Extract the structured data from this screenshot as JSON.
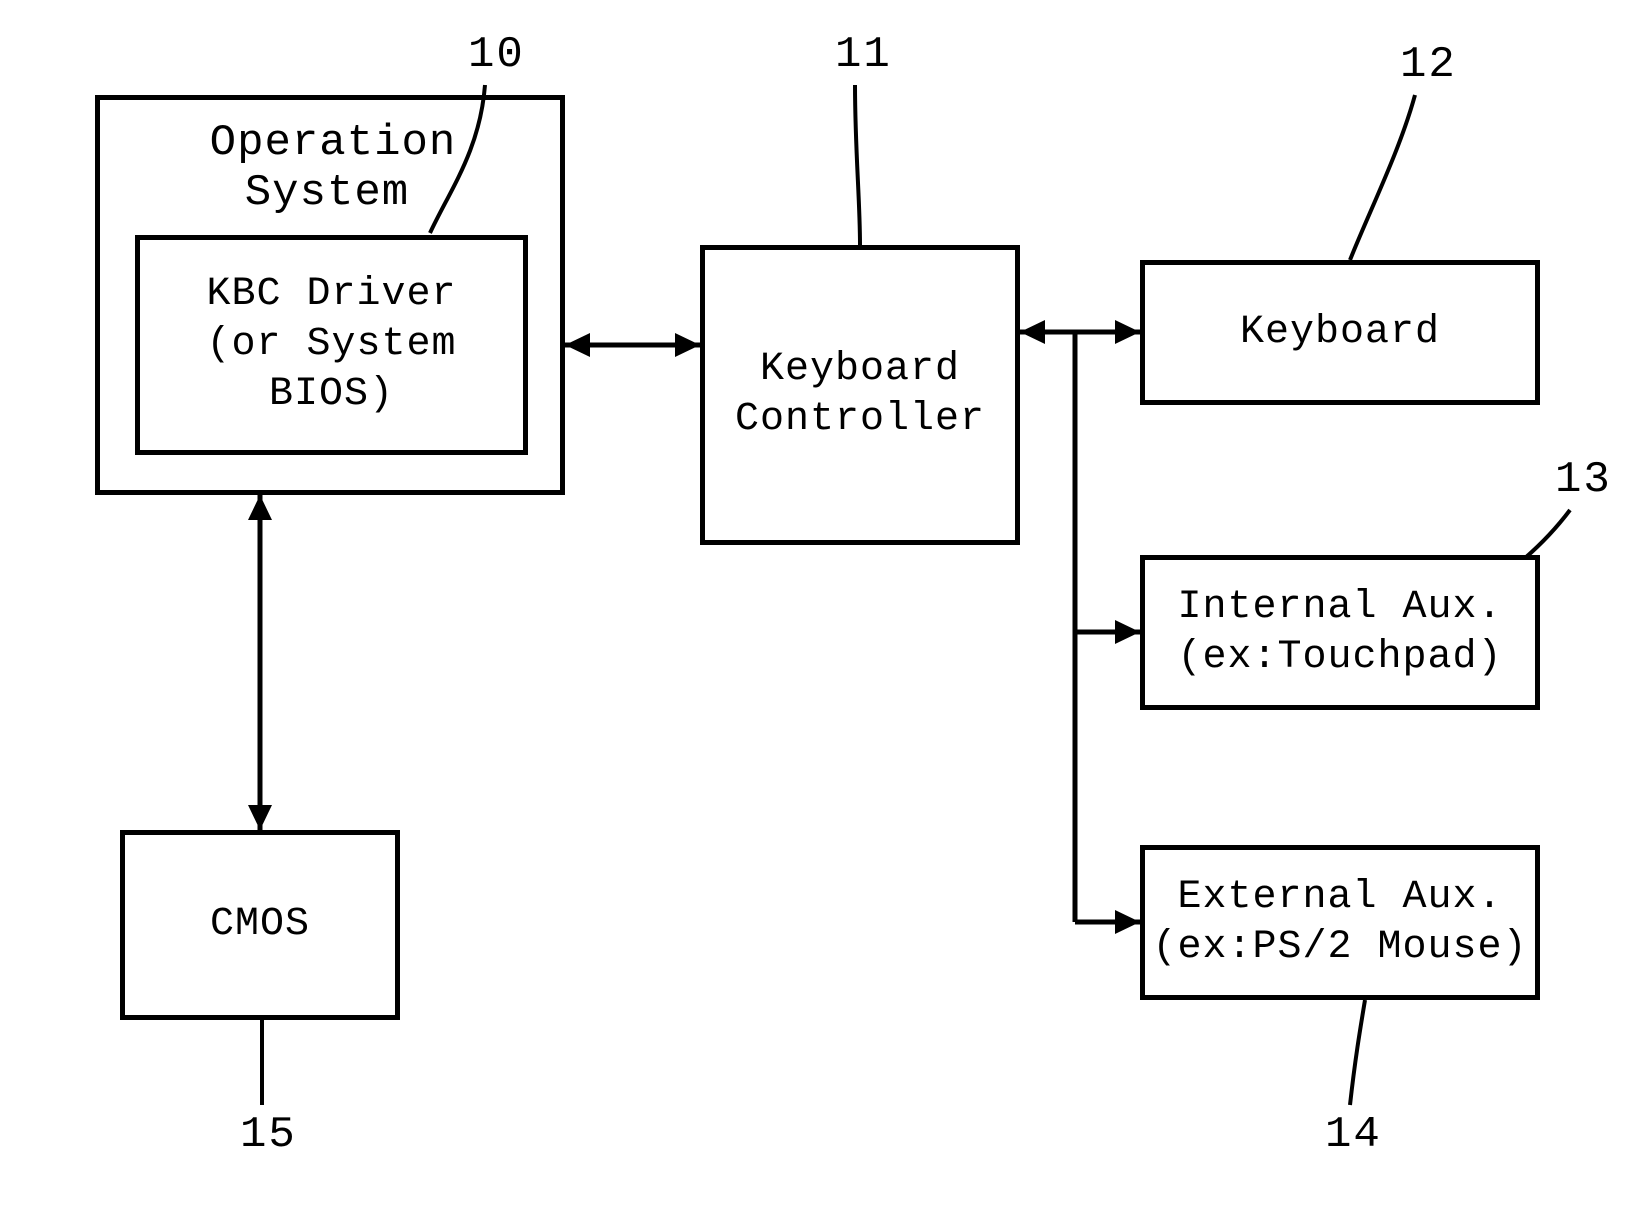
{
  "refs": {
    "r10": "10",
    "r11": "11",
    "r12": "12",
    "r13": "13",
    "r14": "14",
    "r15": "15"
  },
  "blocks": {
    "os_outer": "Operation\nSystem",
    "kbc_driver": "KBC Driver\n(or System\nBIOS)",
    "keyboard_controller": "Keyboard\nController",
    "keyboard": "Keyboard",
    "internal_aux": "Internal Aux.\n(ex:Touchpad)",
    "external_aux": "External Aux.\n(ex:PS/2 Mouse)",
    "cmos": "CMOS"
  }
}
